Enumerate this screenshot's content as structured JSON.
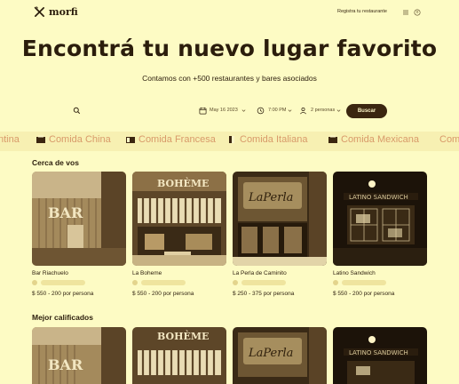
{
  "header": {
    "brand": "morfi",
    "register_link": "Registra tu restaurante"
  },
  "hero": {
    "title": "Encontrá tu nuevo lugar favorito",
    "subtitle": "Contamos con +500 restaurantes y bares asociados"
  },
  "search": {
    "placeholder": "",
    "date": "May 16 2023",
    "time": "7:00 PM",
    "people": "2 personas",
    "button_label": "Buscar"
  },
  "categories": [
    {
      "label": "Comida China"
    },
    {
      "label": "Comida Francesa"
    },
    {
      "label": "Comida Italiana"
    },
    {
      "label": "Comida Mexicana"
    }
  ],
  "categories_cut": {
    "left": "ntina",
    "right": "Com"
  },
  "sections": {
    "nearby": {
      "title": "Cerca de vos",
      "cards": [
        {
          "name": "Bar Riachuelo",
          "price": "$ 550 - 200 por persona"
        },
        {
          "name": "La Boheme",
          "price": "$ 550 - 200 por persona"
        },
        {
          "name": "La Perla de Caminito",
          "price": "$ 250 - 375 por persona"
        },
        {
          "name": "Latino Sandwich",
          "price": "$ 550 - 200 por persona"
        }
      ]
    },
    "top_rated": {
      "title": "Mejor calificados"
    }
  },
  "colors": {
    "background": "#fdfbc4",
    "primary_dark": "#3b2610",
    "category_text": "#d89a6a",
    "strip_bg": "#f7f0b2"
  },
  "icons": [
    "logo-fork-knife-icon",
    "menu-icon",
    "user-icon",
    "search-icon",
    "calendar-icon",
    "clock-icon",
    "person-icon",
    "chevron-down-icon",
    "food-box-icon"
  ]
}
